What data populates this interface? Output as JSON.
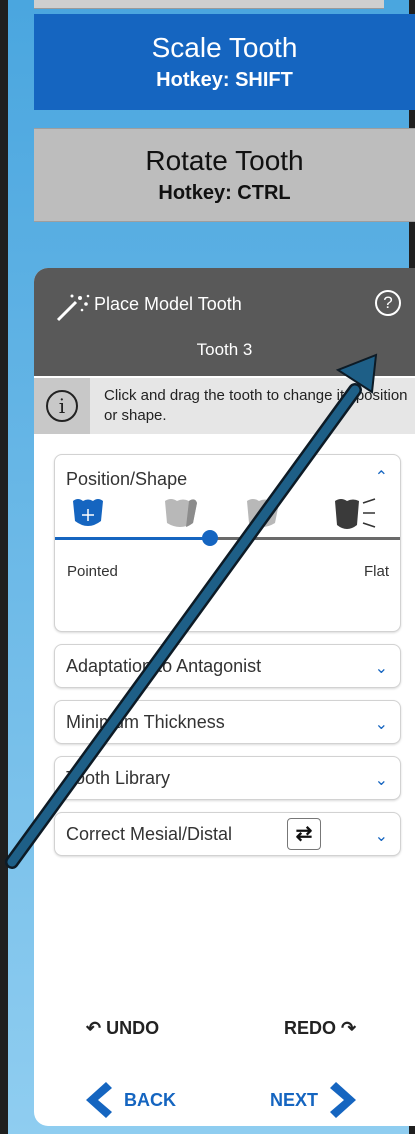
{
  "tools": {
    "scale": {
      "title": "Scale Tooth",
      "hotkey": "Hotkey: SHIFT"
    },
    "rotate": {
      "title": "Rotate Tooth",
      "hotkey": "Hotkey: CTRL"
    }
  },
  "panel": {
    "title": "Place Model Tooth",
    "help_glyph": "?",
    "subtitle": "Tooth 3",
    "info_text": "Click and drag the tooth to change its position or shape.",
    "sections": {
      "position": {
        "label": "Position/Shape",
        "expanded": true,
        "slider": {
          "left_label": "Pointed",
          "right_label": "Flat",
          "value": 0.45
        }
      },
      "adaptation": {
        "label": "Adaptation to Antagonist"
      },
      "thickness": {
        "label": "Minimum Thickness"
      },
      "library": {
        "label": "Tooth Library"
      },
      "mesial": {
        "label": "Correct Mesial/Distal"
      }
    },
    "undo": "UNDO",
    "redo": "REDO",
    "back": "BACK",
    "next": "NEXT"
  },
  "colors": {
    "primary": "#1565c0",
    "header": "#595959",
    "annotation_arrow": "#1e5f87"
  },
  "icons": [
    "magic-wand-icon",
    "help-icon",
    "info-icon",
    "move-tooth-icon",
    "shape-tooth-icon",
    "sculpt-tooth-icon",
    "adjust-tooth-icon",
    "swap-icon",
    "undo-icon",
    "redo-icon",
    "back-arrow-icon",
    "next-arrow-icon"
  ]
}
